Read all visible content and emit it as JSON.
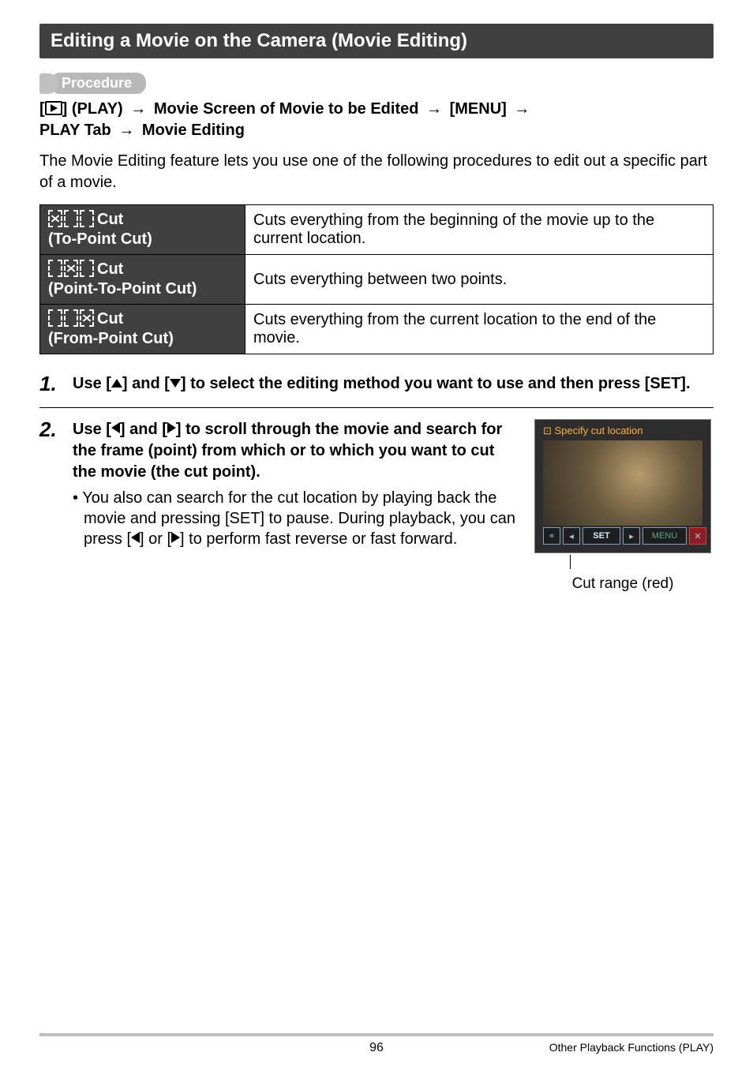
{
  "sectionTitle": "Editing a Movie on the Camera (Movie Editing)",
  "procedureLabel": "Procedure",
  "procedurePath": {
    "seg1": "[",
    "seg2": "] (PLAY)",
    "seg3": "Movie Screen of Movie to be Edited",
    "seg4": "[MENU]",
    "seg5": "PLAY Tab",
    "seg6": "Movie Editing"
  },
  "intro": "The Movie Editing feature lets you use one of the following procedures to edit out a specific part of a movie.",
  "table": {
    "rows": [
      {
        "labelTitle": "Cut",
        "labelSub": "(To-Point Cut)",
        "desc": "Cuts everything from the beginning of the movie up to the current location."
      },
      {
        "labelTitle": "Cut",
        "labelSub": "(Point-To-Point Cut)",
        "desc": "Cuts everything between two points."
      },
      {
        "labelTitle": "Cut",
        "labelSub": "(From-Point Cut)",
        "desc": "Cuts everything from the current location to the end of the movie."
      }
    ]
  },
  "steps": {
    "s1": {
      "num": "1.",
      "pre": "Use [",
      "mid1": "] and [",
      "mid2": "] to select the editing method you want to use and then press [SET]."
    },
    "s2": {
      "num": "2.",
      "pre": "Use [",
      "mid1": "] and [",
      "mid2": "] to scroll through the movie and search for the frame (point) from which or to which you want to cut the movie (the cut point).",
      "notePre": "• You also can search for the cut location by playing back the movie and pressing [SET] to pause. During playback, you can press [",
      "noteMid": "] or [",
      "notePost": "] to perform fast reverse or fast forward."
    }
  },
  "thumb": {
    "header": "⊡ Specify cut location",
    "set": "SET",
    "menu": "MENU",
    "left": "◂",
    "right": "▸",
    "fastL": "«",
    "close": "✕"
  },
  "caption": "Cut range (red)",
  "footer": {
    "page": "96",
    "right": "Other Playback Functions (PLAY)"
  }
}
